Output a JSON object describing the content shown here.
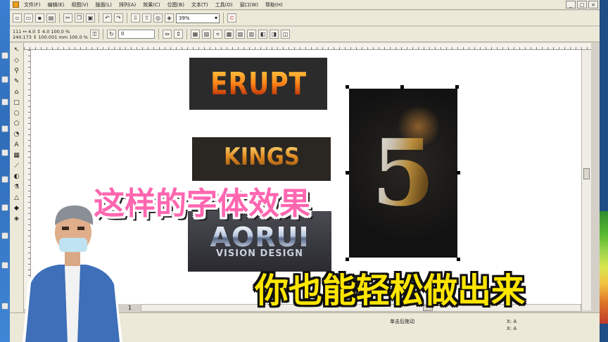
{
  "menubar": {
    "items": [
      "文件(F)",
      "编辑(E)",
      "视图(V)",
      "版面(L)",
      "排列(A)",
      "效果(C)",
      "位图(B)",
      "文本(T)",
      "工具(O)",
      "窗口(W)",
      "帮助(H)"
    ],
    "window_buttons": [
      "_",
      "□",
      "×"
    ]
  },
  "toolbar": {
    "zoom_value": "39%",
    "coords_x": "111",
    "coords_line1": "111 ↔ 4.0   ↕ 4.0  100.0 %",
    "coords_line2": "240.173 ↕ 100.001 mm   100.0 %",
    "rotation_value": "0"
  },
  "artworks": {
    "erupt": "ERUPT",
    "kings": "KINGS",
    "aorui_main": "AORUI",
    "aorui_sub": "VISION DESIGN",
    "five": "5"
  },
  "captions": {
    "line1": "这样的字体效果",
    "line2": "你也能轻松做出来"
  },
  "page": {
    "number": "1"
  },
  "status": {
    "left": "单击后拖动",
    "right1": "X: A",
    "right2": "X: A"
  },
  "colors": {
    "caption1": "#ff66b0",
    "caption2": "#ffe600",
    "canvas": "#ffffff",
    "ui": "#ece9d8"
  }
}
